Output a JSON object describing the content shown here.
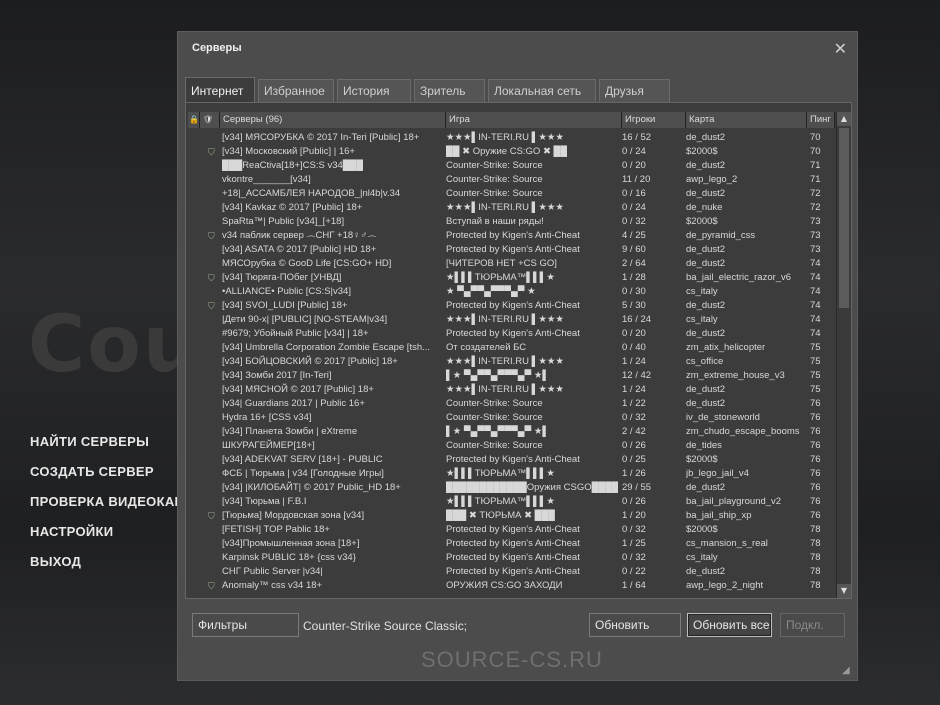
{
  "background": {
    "logo_text": "Counter-Strike"
  },
  "main_menu": [
    "НАЙТИ СЕРВЕРЫ",
    "СОЗДАТЬ СЕРВЕР",
    "ПРОВЕРКА ВИДЕОКАРТЫ",
    "НАСТРОЙКИ",
    "ВЫХОД"
  ],
  "watermark": "SOURCE-CS.RU",
  "dialog": {
    "title": "Серверы",
    "close_glyph": "✕",
    "tabs": [
      {
        "label": "Интернет",
        "active": true
      },
      {
        "label": "Избранное"
      },
      {
        "label": "История"
      },
      {
        "label": "Зритель"
      },
      {
        "label": "Локальная сеть"
      },
      {
        "label": "Друзья"
      }
    ],
    "columns": {
      "lock": "🔒",
      "vac": "🛡",
      "name": "Серверы (96)",
      "game": "Игра",
      "players": "Игроки",
      "map": "Карта",
      "ping": "Пинг"
    },
    "rows": [
      {
        "vac": "",
        "name": "[v34] МЯСОРУБКА © 2017 In-Teri [Public] 18+",
        "game": "★★★▌IN-TERI.RU ▌★★★",
        "players": "16 / 52",
        "map": "de_dust2",
        "ping": "70"
      },
      {
        "vac": "⛉",
        "name": "[v34] Московский [Public] | 16+",
        "game": "██ ✖ Оружие CS:GO ✖ ██",
        "players": "0 / 24",
        "map": "$2000$",
        "ping": "70"
      },
      {
        "vac": "",
        "name": "███ReaCtiva[18+]CS:S v34███",
        "game": "Counter-Strike: Source",
        "players": "0 / 20",
        "map": "de_dust2",
        "ping": "71"
      },
      {
        "vac": "",
        "name": "vkontre_______[v34]",
        "game": "Counter-Strike: Source",
        "players": "11 / 20",
        "map": "awp_lego_2",
        "ping": "71"
      },
      {
        "vac": "",
        "name": "+18|_АССАМБЛЕЯ НАРОДОВ_|nl4b|v.34",
        "game": "Counter-Strike: Source",
        "players": "0 / 16",
        "map": "de_dust2",
        "ping": "72"
      },
      {
        "vac": "",
        "name": "[v34] Kavkaz © 2017 [Public] 18+",
        "game": "★★★▌IN-TERI.RU ▌★★★",
        "players": "0 / 24",
        "map": "de_nuke",
        "ping": "72"
      },
      {
        "vac": "",
        "name": "SpaRta™| Public [v34]_[+18]",
        "game": "Вступай в наши ряды!",
        "players": "0 / 32",
        "map": "$2000$",
        "ping": "73"
      },
      {
        "vac": "⛉",
        "name": "v34 паблик сервер ෴СНГ +18♀♂෴",
        "game": "Protected by Kigen's Anti-Cheat",
        "players": "4 / 25",
        "map": "de_pyramid_css",
        "ping": "73"
      },
      {
        "vac": "",
        "name": "[v34] ASATA © 2017 [Public] HD 18+",
        "game": "Protected by Kigen's Anti-Cheat",
        "players": "9 / 60",
        "map": "de_dust2",
        "ping": "73"
      },
      {
        "vac": "",
        "name": "МЯСОрубка © GooD Life [CS:GO+ HD]",
        "game": "[ЧИТЕРОВ НЕТ +CS GO]",
        "players": "2 / 64",
        "map": "de_dust2",
        "ping": "74"
      },
      {
        "vac": "⛉",
        "name": "[v34] Тюряга-ПОбег [УНВД]",
        "game": "★▌▌▌ТЮРЬМА™▌▌▌★",
        "players": "1 / 28",
        "map": "ba_jail_electric_razor_v6",
        "ping": "74"
      },
      {
        "vac": "",
        "name": "•ALLIANCE• Public [CS:S|v34]",
        "game": "★ ▀▄▀▀▄▀▀▀▄▀ ★",
        "players": "0 / 30",
        "map": "cs_italy",
        "ping": "74"
      },
      {
        "vac": "⛉",
        "name": "[v34]    SVOI_LUDI   [Public]   18+",
        "game": "Protected by Kigen's Anti-Cheat",
        "players": "5 / 30",
        "map": "de_dust2",
        "ping": "74"
      },
      {
        "vac": "",
        "name": "|Дети 90-х| [PUBLIC] [NO-STEAM|v34]",
        "game": "★★★▌IN-TERI.RU ▌★★★",
        "players": "16 / 24",
        "map": "cs_italy",
        "ping": "74"
      },
      {
        "vac": "",
        "name": "#9679; Убойный Public [v34] | 18+",
        "game": "Protected by Kigen's Anti-Cheat",
        "players": "0 / 20",
        "map": "de_dust2",
        "ping": "74"
      },
      {
        "vac": "",
        "name": "[v34] Umbrella Corporation Zombie Escape [tsh...",
        "game": "От создателей БС",
        "players": "0 / 40",
        "map": "zm_atix_helicopter",
        "ping": "75"
      },
      {
        "vac": "",
        "name": "[v34] БОЙЦОВСКИЙ © 2017 [Public] 18+",
        "game": "★★★▌IN-TERI.RU ▌★★★",
        "players": "1 / 24",
        "map": "cs_office",
        "ping": "75"
      },
      {
        "vac": "",
        "name": "[v34] Зомби 2017 [In-Teri]",
        "game": "▌★ ▀▄▀▀▄▀▀▀▄▀ ★▌",
        "players": "12 / 42",
        "map": "zm_extreme_house_v3",
        "ping": "75"
      },
      {
        "vac": "",
        "name": "[v34] МЯСНОЙ © 2017 [Public] 18+",
        "game": "★★★▌IN-TERI.RU ▌★★★",
        "players": "1 / 24",
        "map": "de_dust2",
        "ping": "75"
      },
      {
        "vac": "",
        "name": "|v34| Guardians 2017 | Public 16+",
        "game": "Counter-Strike: Source",
        "players": "1 / 22",
        "map": "de_dust2",
        "ping": "76"
      },
      {
        "vac": "",
        "name": "Hydra 16+ [CSS v34]",
        "game": "Counter-Strike: Source",
        "players": "0 / 32",
        "map": "iv_de_stoneworld",
        "ping": "76"
      },
      {
        "vac": "",
        "name": "[v34] Планета Зомби | eXtreme",
        "game": "▌★ ▀▄▀▀▄▀▀▀▄▀ ★▌",
        "players": "2 / 42",
        "map": "zm_chudo_escape_booms",
        "ping": "76"
      },
      {
        "vac": "",
        "name": "ШКУРАГЕЙМЕР[18+]",
        "game": "Counter-Strike: Source",
        "players": "0 / 26",
        "map": "de_tides",
        "ping": "76"
      },
      {
        "vac": "",
        "name": "[v34] ADEKVAT SERV [18+] - PUBLIC",
        "game": "Protected by Kigen's Anti-Cheat",
        "players": "0 / 25",
        "map": "$2000$",
        "ping": "76"
      },
      {
        "vac": "",
        "name": "ФСБ | Тюрьма | v34 [Голодные Игры]",
        "game": "★▌▌▌ТЮРЬМА™▌▌▌★",
        "players": "1 / 26",
        "map": "jb_lego_jail_v4",
        "ping": "76"
      },
      {
        "vac": "",
        "name": "[v34] |КИЛОБАЙТ| © 2017 Public_HD 18+",
        "game": "████████████Оружия CSGO██████",
        "players": "29 / 55",
        "map": "de_dust2",
        "ping": "76"
      },
      {
        "vac": "",
        "name": "[v34] Тюрьма | F.B.I",
        "game": "★▌▌▌ТЮРЬМА™▌▌▌★",
        "players": "0 / 26",
        "map": "ba_jail_playground_v2",
        "ping": "76"
      },
      {
        "vac": "⛉",
        "name": "[Тюрьма] Мордовская зона [v34]",
        "game": "███ ✖ ТЮРЬМА ✖ ███",
        "players": "1 / 20",
        "map": "ba_jail_ship_xp",
        "ping": "76"
      },
      {
        "vac": "",
        "name": "[FETISH] TOP Pablic 18+",
        "game": "Protected by Kigen's Anti-Cheat",
        "players": "0 / 32",
        "map": "$2000$",
        "ping": "78"
      },
      {
        "vac": "",
        "name": "[v34]Промышленная зона [18+]",
        "game": "Protected by Kigen's Anti-Cheat",
        "players": "1 / 25",
        "map": "cs_mansion_s_real",
        "ping": "78"
      },
      {
        "vac": "",
        "name": "Karpinsk PUBLIC 18+ {css v34}",
        "game": "Protected by Kigen's Anti-Cheat",
        "players": "0 / 32",
        "map": "cs_italy",
        "ping": "78"
      },
      {
        "vac": "",
        "name": "СНГ Public Server |v34|",
        "game": "Protected by Kigen's Anti-Cheat",
        "players": "0 / 22",
        "map": "de_dust2",
        "ping": "78"
      },
      {
        "vac": "⛉",
        "name": "Anomaly™ css v34 18+",
        "game": "ОРУЖИЯ CS:GO ЗАХОДИ",
        "players": "1 / 64",
        "map": "awp_lego_2_night",
        "ping": "78"
      }
    ],
    "filters_button": "Фильтры",
    "filter_description": "Counter-Strike Source Classic;",
    "refresh_button": "Обновить",
    "refresh_all_button": "Обновить все",
    "connect_button": "Подкл.",
    "resize_grip": "◢"
  }
}
